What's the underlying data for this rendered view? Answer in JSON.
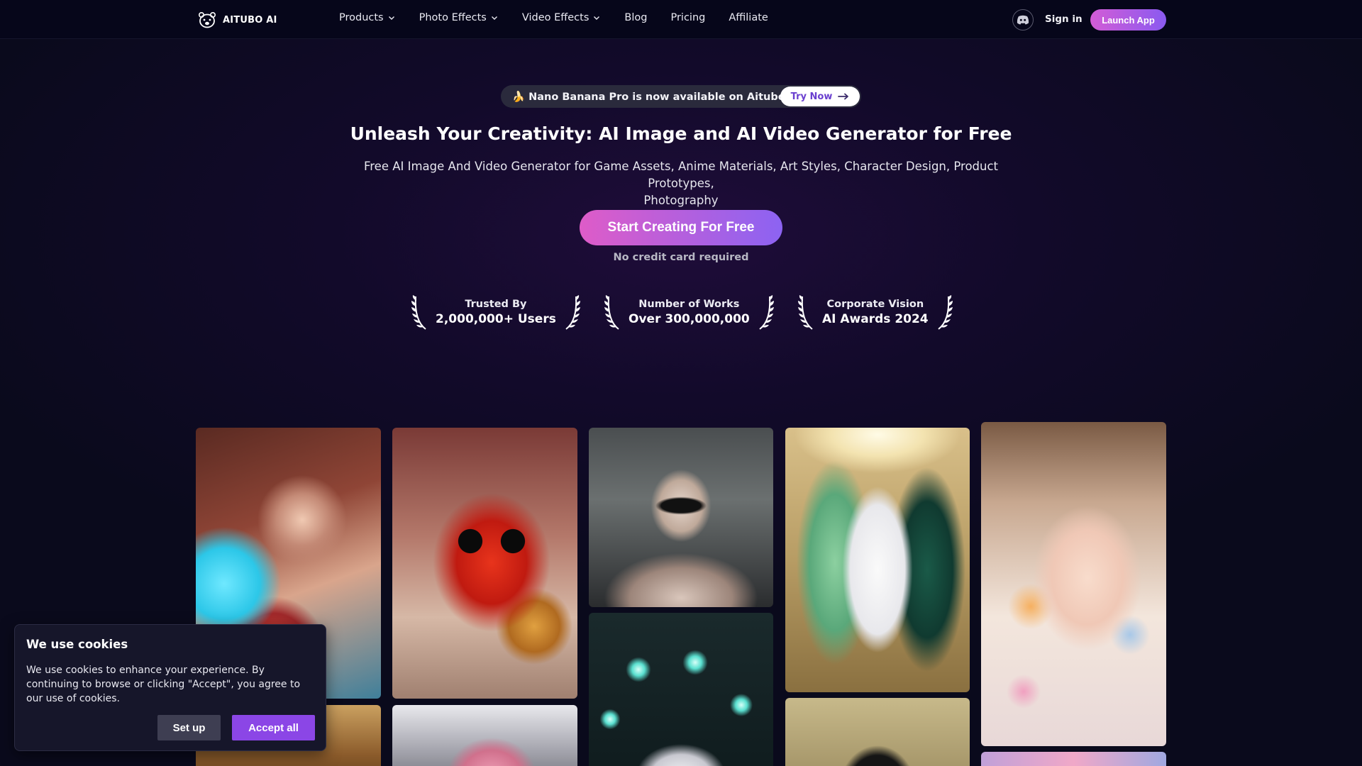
{
  "nav": {
    "brand": "AITUBO AI",
    "items": [
      {
        "label": "Products",
        "dropdown": true
      },
      {
        "label": "Photo Effects",
        "dropdown": true
      },
      {
        "label": "Video Effects",
        "dropdown": true
      },
      {
        "label": "Blog",
        "dropdown": false
      },
      {
        "label": "Pricing",
        "dropdown": false
      },
      {
        "label": "Affiliate",
        "dropdown": false
      }
    ],
    "discord_icon": "discord-icon",
    "signin_label": "Sign in",
    "launch_label": "Launch App"
  },
  "announce": {
    "text": "🍌 Nano Banana Pro is now available on Aitubo",
    "button_label": "Try Now"
  },
  "hero": {
    "title": "Unleash Your Creativity: AI Image and AI Video Generator for Free",
    "subtitle_line1": "Free AI Image And Video Generator for Game Assets, Anime Materials, Art Styles, Character Design, Product Prototypes,",
    "subtitle_line2": "Photography",
    "cta_label": "Start Creating For Free",
    "cta_note": "No credit card required"
  },
  "awards": [
    {
      "top": "Trusted By",
      "bottom": "2,000,000+ Users"
    },
    {
      "top": "Number of Works",
      "bottom": "Over 300,000,000"
    },
    {
      "top": "Corporate Vision",
      "bottom": "AI Awards 2024"
    }
  ],
  "gallery": {
    "images": [
      "anime-fighter",
      "red-fluffy-bird",
      "lace-mask-woman",
      "green-hair-knight",
      "pastel-portrait",
      "glowing-light-bulbs",
      "pink-hair-car",
      "dark-wolf",
      "lamp-room",
      "pink-partial"
    ]
  },
  "cookie": {
    "title": "We use cookies",
    "text": "We use cookies to enhance your experience. By continuing to browse or clicking \"Accept\", you agree to our use of cookies.",
    "setup_label": "Set up",
    "accept_label": "Accept all"
  },
  "colors": {
    "accent_gradient_start": "#de5cc8",
    "accent_gradient_end": "#8c63f2",
    "accept_button": "#8b46e6",
    "nav_background": "#06061a"
  }
}
